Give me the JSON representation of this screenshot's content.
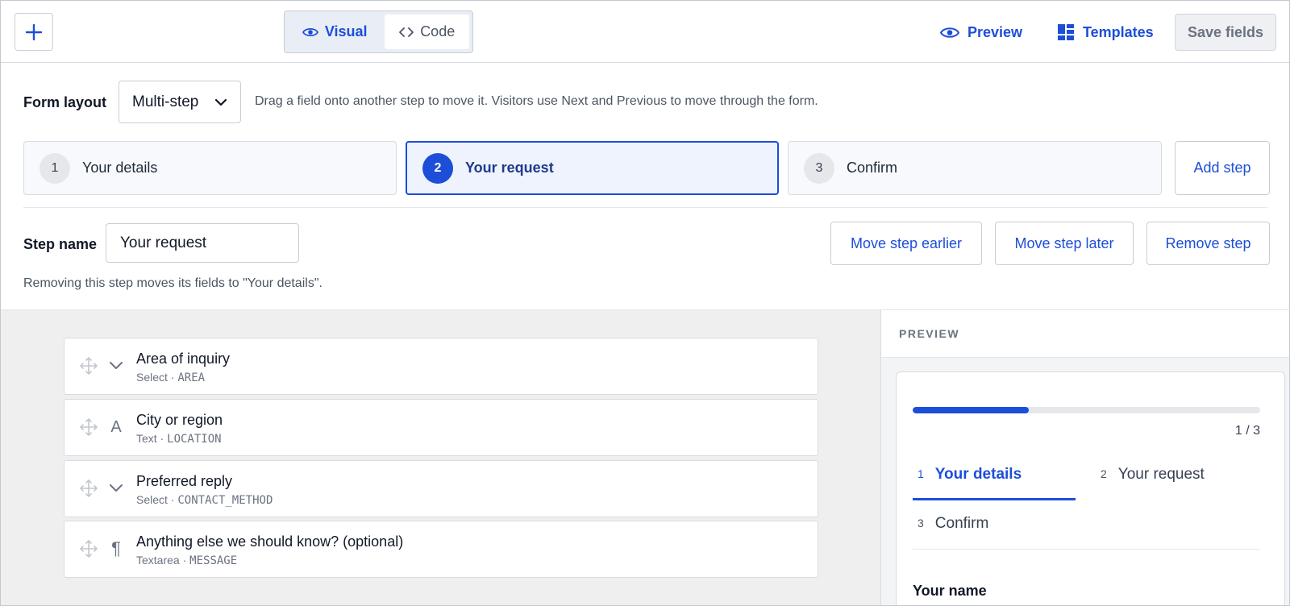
{
  "toolbar": {
    "mode_visual": "Visual",
    "mode_code": "Code",
    "preview_label": "Preview",
    "templates_label": "Templates",
    "save_label": "Save fields"
  },
  "settings": {
    "form_layout_label": "Form layout",
    "form_layout_value": "Multi-step",
    "form_layout_hint": "Drag a field onto another step to move it. Visitors use Next and Previous to move through the form.",
    "steps": [
      {
        "number": "1",
        "label": "Your details"
      },
      {
        "number": "2",
        "label": "Your request"
      },
      {
        "number": "3",
        "label": "Confirm"
      }
    ],
    "add_step_label": "Add step",
    "step_name_label": "Step name",
    "step_name_value": "Your request",
    "move_earlier_label": "Move step earlier",
    "move_later_label": "Move step later",
    "remove_step_label": "Remove step",
    "remove_hint": "Removing this step moves its fields to \"Your details\"."
  },
  "fields": [
    {
      "name": "Area of inquiry",
      "type": "Select",
      "key": "AREA",
      "icon": "chevron-down-icon"
    },
    {
      "name": "City or region",
      "type": "Text",
      "key": "LOCATION",
      "icon": "text-letter-icon",
      "glyph": "A"
    },
    {
      "name": "Preferred reply",
      "type": "Select",
      "key": "CONTACT_METHOD",
      "icon": "chevron-down-icon"
    },
    {
      "name": "Anything else we should know? (optional)",
      "type": "Textarea",
      "key": "MESSAGE",
      "icon": "paragraph-icon",
      "glyph": "¶"
    }
  ],
  "field_meta_separator": " · ",
  "preview": {
    "heading": "PREVIEW",
    "progress_fraction": 0.333,
    "count": "1 / 3",
    "tabs": [
      {
        "number": "1",
        "label": "Your details"
      },
      {
        "number": "2",
        "label": "Your request"
      },
      {
        "number": "3",
        "label": "Confirm"
      }
    ],
    "first_field_label": "Your name"
  },
  "colors": {
    "accent": "#1d4ed8",
    "active_step_bg": "#eef3fd",
    "canvas_bg": "#efefef"
  }
}
